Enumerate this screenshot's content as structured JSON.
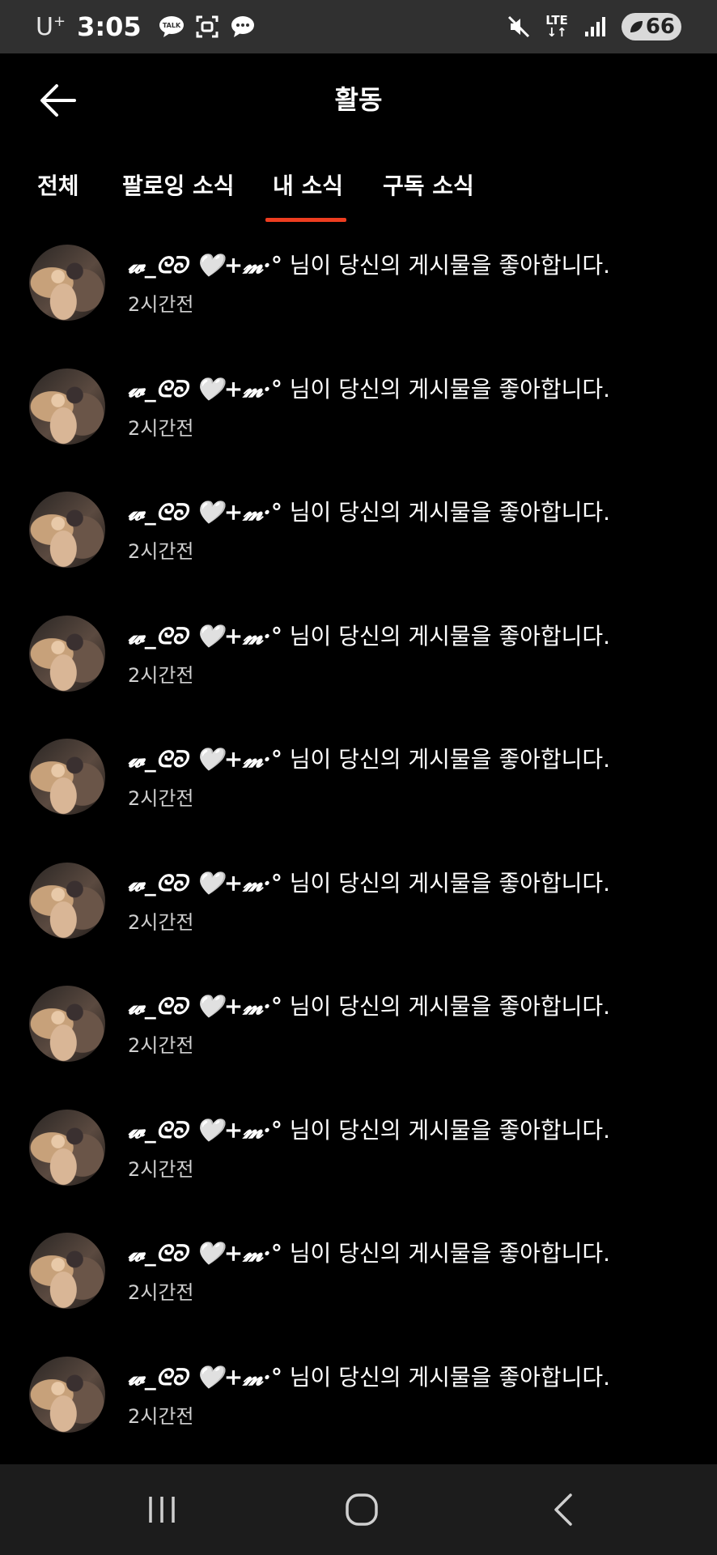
{
  "status_bar": {
    "carrier": "U",
    "carrier_sup": "+",
    "time": "3:05",
    "lte_top": "LTE",
    "lte_bottom": "↓↑",
    "battery": "66",
    "icons": [
      "kakaotalk-icon",
      "screenshot-icon",
      "chat-bubble-icon",
      "mute-icon",
      "lte-icon",
      "signal-icon",
      "battery-icon"
    ]
  },
  "header": {
    "title": "활동",
    "back_icon": "arrow-left-icon"
  },
  "tabs": [
    {
      "label": "전체",
      "active": false
    },
    {
      "label": "팔로잉 소식",
      "active": false
    },
    {
      "label": "내 소식",
      "active": true
    },
    {
      "label": "구독 소식",
      "active": false
    }
  ],
  "accent_color": "#ee3d20",
  "notifications": [
    {
      "user": "𝔀_ᘓᘐ 🤍+𝓶·°",
      "message": " 님이 당신의 게시물을 좋아합니다.",
      "time": "2시간전"
    },
    {
      "user": "𝔀_ᘓᘐ 🤍+𝓶·°",
      "message": " 님이 당신의 게시물을 좋아합니다.",
      "time": "2시간전"
    },
    {
      "user": "𝔀_ᘓᘐ 🤍+𝓶·°",
      "message": " 님이 당신의 게시물을 좋아합니다.",
      "time": "2시간전"
    },
    {
      "user": "𝔀_ᘓᘐ 🤍+𝓶·°",
      "message": " 님이 당신의 게시물을 좋아합니다.",
      "time": "2시간전"
    },
    {
      "user": "𝔀_ᘓᘐ 🤍+𝓶·°",
      "message": " 님이 당신의 게시물을 좋아합니다.",
      "time": "2시간전"
    },
    {
      "user": "𝔀_ᘓᘐ 🤍+𝓶·°",
      "message": " 님이 당신의 게시물을 좋아합니다.",
      "time": "2시간전"
    },
    {
      "user": "𝔀_ᘓᘐ 🤍+𝓶·°",
      "message": " 님이 당신의 게시물을 좋아합니다.",
      "time": "2시간전"
    },
    {
      "user": "𝔀_ᘓᘐ 🤍+𝓶·°",
      "message": " 님이 당신의 게시물을 좋아합니다.",
      "time": "2시간전"
    },
    {
      "user": "𝔀_ᘓᘐ 🤍+𝓶·°",
      "message": " 님이 당신의 게시물을 좋아합니다.",
      "time": "2시간전"
    },
    {
      "user": "𝔀_ᘓᘐ 🤍+𝓶·°",
      "message": " 님이 당신의 게시물을 좋아합니다.",
      "time": "2시간전"
    }
  ],
  "nav_bar": {
    "icons": [
      "recent-apps-icon",
      "home-icon",
      "back-icon"
    ]
  }
}
